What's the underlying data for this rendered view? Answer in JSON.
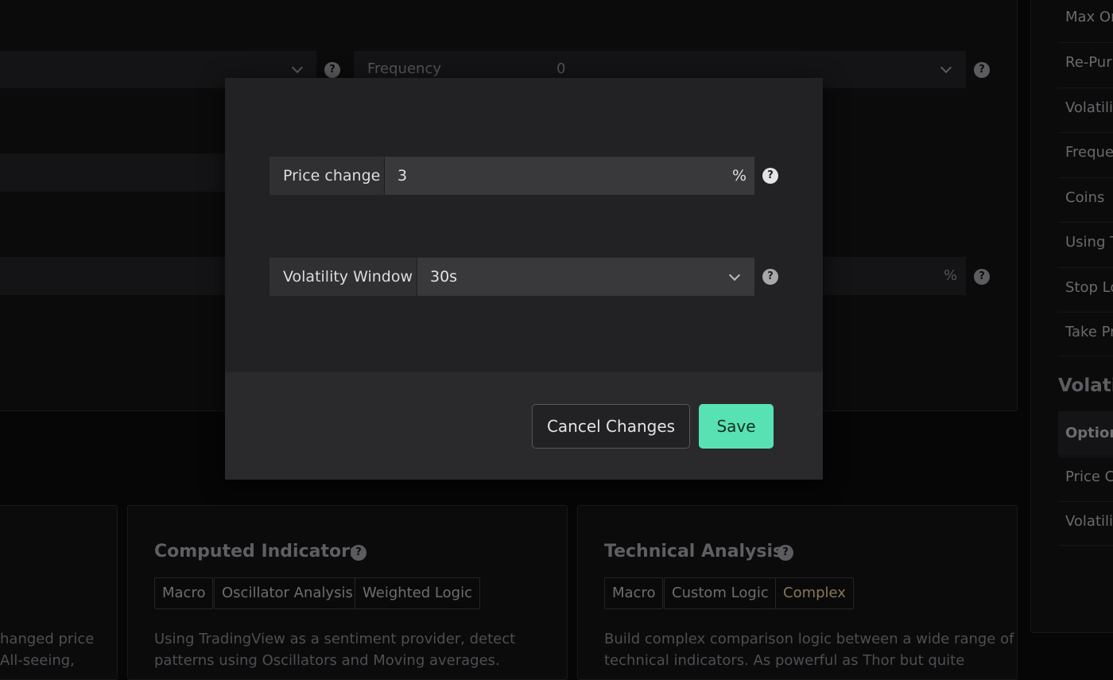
{
  "background": {
    "frequency_label": "Frequency",
    "frequency_value": "0",
    "percent_suffix": "%"
  },
  "sidebar": {
    "items": [
      "Max Ord",
      "Re-Pur",
      "Volatili",
      "Freque",
      "Coins",
      "Using T",
      "Stop Lo",
      "Take Pr"
    ],
    "section_title": "Volatil",
    "table_header": "Option",
    "table_rows": [
      "Price C",
      "Volatili"
    ]
  },
  "cards": [
    {
      "title": "Computed Indicators",
      "tags": [
        "Macro",
        "Oscillator Analysis",
        "Weighted Logic"
      ],
      "desc_line1": "Using TradingView as a sentiment provider, detect",
      "desc_line2": "patterns using Oscillators and Moving averages."
    },
    {
      "title": "Technical Analysis",
      "tags": [
        "Macro",
        "Custom Logic",
        "Complex"
      ],
      "desc_line1": "Build complex comparison logic between a wide range of",
      "desc_line2": "technical indicators. As powerful as Thor but quite"
    }
  ],
  "left_card": {
    "desc_line1": "hanged price",
    "desc_line2": "All-seeing,"
  },
  "modal": {
    "price_change_label": "Price change",
    "price_change_value": "3",
    "price_change_suffix": "%",
    "volatility_window_label": "Volatility Window",
    "volatility_window_value": "30s",
    "cancel_label": "Cancel Changes",
    "save_label": "Save"
  },
  "icons": {
    "help_glyph": "?"
  },
  "colors": {
    "accent_save": "#58e2b3",
    "complex_tag": "#8a7656"
  }
}
